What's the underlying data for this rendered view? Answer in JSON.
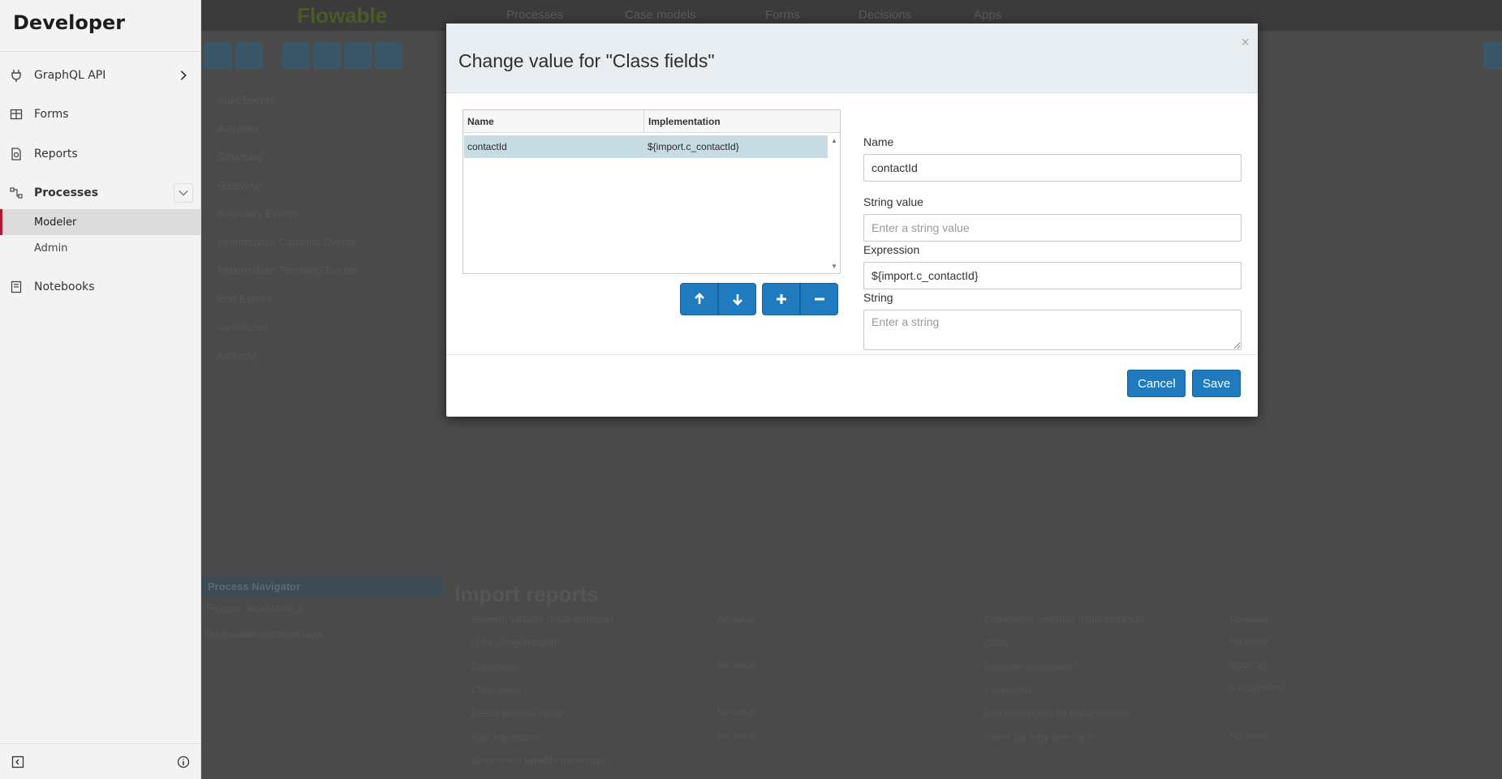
{
  "sidebar": {
    "title": "Developer",
    "items": [
      {
        "label": "GraphQL API",
        "icon": "plug-icon"
      },
      {
        "label": "Forms",
        "icon": "table-icon"
      },
      {
        "label": "Reports",
        "icon": "report-icon"
      },
      {
        "label": "Processes",
        "icon": "process-icon"
      },
      {
        "label": "Notebooks",
        "icon": "notebook-icon"
      }
    ],
    "sub_items": [
      {
        "label": "Modeler",
        "active": true
      },
      {
        "label": "Admin",
        "active": false
      }
    ]
  },
  "background": {
    "logo": "Flowable",
    "nav": [
      "Processes",
      "Case models",
      "Forms",
      "Decisions",
      "Apps"
    ],
    "palette": [
      "Start Events",
      "Activities",
      "Structural",
      "Gateways",
      "Boundary Events",
      "Intermediate Catching Events",
      "Intermediate Throwing Events",
      "End Events",
      "Swimlanes",
      "Artifacts"
    ],
    "navigator_title": "Process Navigator",
    "navigator_process": "Process: importdata_2",
    "navigator_empty": "No flowable elements used",
    "properties_title": "Import reports",
    "props_left": [
      {
        "label": "Element variable (multi-instance) :",
        "value": "Ac.value"
      },
      {
        "label": "Is for compensation :",
        "value": ""
      },
      {
        "label": "Expression :",
        "value": "No value"
      },
      {
        "label": "Class fields :",
        "value": ""
      },
      {
        "label": "Result variable name :",
        "value": "No value"
      },
      {
        "label": "Skip expression :",
        "value": "No value"
      },
      {
        "label": "Store result variable transiently :",
        "value": ""
      }
    ],
    "props_right": [
      {
        "label": "Completion condition (multi-instance) :",
        "value": "No value"
      },
      {
        "label": "Class :",
        "value": "No value"
      },
      {
        "label": "Delegate expression :",
        "value": "${policy}"
      },
      {
        "label": "Exceptions :",
        "value": "0 exceptions"
      },
      {
        "label": "Use local scope for result variable :",
        "value": ""
      },
      {
        "label": "Failed job retry time cycle :",
        "value": "No value"
      }
    ]
  },
  "modal": {
    "title": "Change value for \"Class fields\"",
    "close": "×",
    "grid": {
      "columns": [
        "Name",
        "Implementation"
      ],
      "rows": [
        {
          "name": "contactId",
          "implementation": "${import.c_contactId}"
        }
      ]
    },
    "form": {
      "name_label": "Name",
      "name_value": "contactId",
      "string_value_label": "String value",
      "string_value_placeholder": "Enter a string value",
      "expression_label": "Expression",
      "expression_value": "${import.c_contactId}",
      "string_label": "String",
      "string_placeholder": "Enter a string"
    },
    "cancel_label": "Cancel",
    "save_label": "Save"
  },
  "colors": {
    "primary_button": "#1f7bbd",
    "selected_row": "#c6dbe2",
    "active_accent": "#b5152b"
  }
}
